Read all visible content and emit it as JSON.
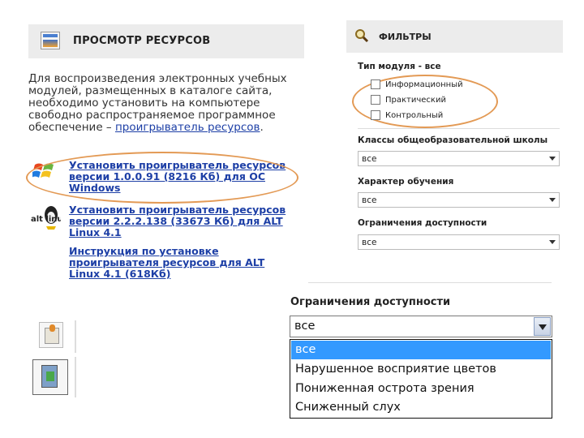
{
  "resources_panel": {
    "title": "ПРОСМОТР РЕСУРСОВ",
    "desc_lines": [
      "Для воспроизведения электронных учебных",
      "модулей, размещенных в каталоге сайта,",
      "необходимо установить на компьютере",
      "свободно распространяемое программное"
    ],
    "desc_last_prefix": "обеспечение – ",
    "desc_link": "проигрыватель ресурсов",
    "desc_last_suffix": ".",
    "windows_link_lines": [
      "Установить проигрыватель ресурсов",
      "версии 1.0.0.91 (8216 Кб) для ОС",
      "Windows"
    ],
    "alt_link_lines": [
      "Установить проигрыватель ресурсов",
      "версии 2.2.2.138 (33673 Кб) для ALT",
      "Linux 4.1"
    ],
    "instr_link_lines": [
      "Инструкция по установке",
      "проигрывателя ресурсов для ALT",
      "Linux 4.1 (618Кб)"
    ],
    "alt_icon_text": "alt linux"
  },
  "filters_panel": {
    "title": "ФИЛЬТРЫ",
    "module_type_label": "Тип модуля - все",
    "module_types": [
      "Информационный",
      "Практический",
      "Контрольный"
    ],
    "class_label": "Классы общеобразовательной школы",
    "class_value": "все",
    "learning_label": "Характер обучения",
    "learning_value": "все",
    "access_label": "Ограничения доступности",
    "access_value": "все"
  },
  "zoom_dropdown": {
    "label": "Ограничения доступности",
    "value": "все",
    "options": [
      "все",
      "Нарушенное восприятие цветов",
      "Пониженная острота зрения",
      "Сниженный слух"
    ],
    "selected_index": 0,
    "highlight_color": "#3399ff"
  },
  "colors": {
    "link": "#1d3fa6",
    "annotation": "#e39a55",
    "panel_header": "#ececec"
  }
}
